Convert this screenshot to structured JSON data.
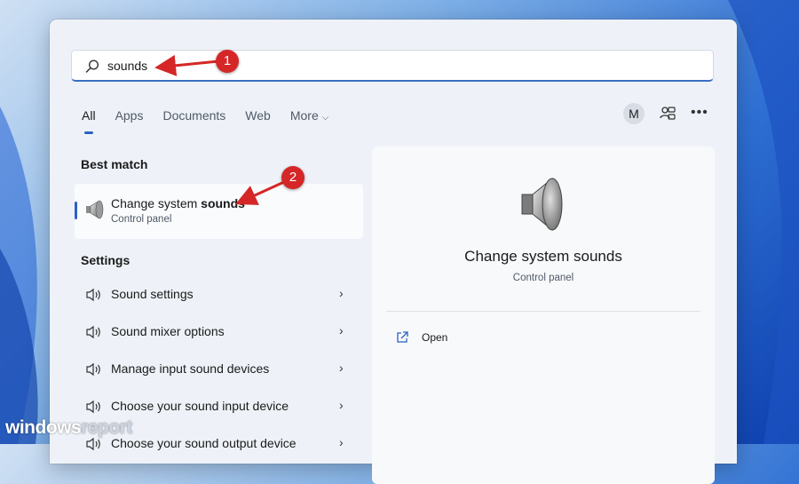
{
  "search": {
    "query": "sounds"
  },
  "tabs": [
    {
      "label": "All",
      "active": true
    },
    {
      "label": "Apps"
    },
    {
      "label": "Documents"
    },
    {
      "label": "Web"
    },
    {
      "label": "More"
    }
  ],
  "header": {
    "avatar_letter": "M",
    "more_icon": "ellipsis-icon",
    "people_icon": "account-switch-icon"
  },
  "best_match": {
    "section_title": "Best match",
    "title_prefix": "Change system ",
    "title_bold": "sounds",
    "subtitle": "Control panel",
    "icon": "speaker-icon"
  },
  "settings": {
    "section_title": "Settings",
    "items": [
      {
        "label": "Sound settings"
      },
      {
        "label": "Sound mixer options"
      },
      {
        "label": "Manage input sound devices"
      },
      {
        "label": "Choose your sound input device"
      },
      {
        "label": "Choose your sound output device"
      }
    ]
  },
  "detail": {
    "title": "Change system sounds",
    "subtitle": "Control panel",
    "actions": [
      {
        "label": "Open",
        "icon": "open-external-icon"
      }
    ]
  },
  "callouts": [
    {
      "number": "1"
    },
    {
      "number": "2"
    }
  ],
  "watermark": {
    "part1": "windows",
    "part2": "report"
  },
  "colors": {
    "accent": "#2a62c4",
    "callout": "#d52727"
  }
}
